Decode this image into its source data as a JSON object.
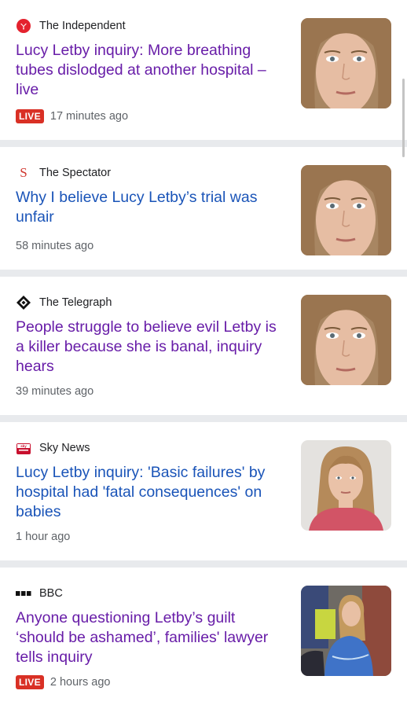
{
  "articles": [
    {
      "source": "The Independent",
      "icon": "independent-logo-icon",
      "headline": "Lucy Letby inquiry: More breathing tubes dislodged at another hospital – live",
      "live": "LIVE",
      "time": "17 minutes ago",
      "visited": true
    },
    {
      "source": "The Spectator",
      "icon": "spectator-logo-icon",
      "headline": "Why I believe Lucy Letby’s trial was unfair",
      "live": null,
      "time": "58 minutes ago",
      "visited": false
    },
    {
      "source": "The Telegraph",
      "icon": "telegraph-logo-icon",
      "headline": "People struggle to believe evil Letby is a killer because she is banal, inquiry hears",
      "live": null,
      "time": "39 minutes ago",
      "visited": true
    },
    {
      "source": "Sky News",
      "icon": "sky-news-logo-icon",
      "headline": "Lucy Letby inquiry: 'Basic failures' by hospital had 'fatal consequences' on babies",
      "live": null,
      "time": "1 hour ago",
      "visited": false
    },
    {
      "source": "BBC",
      "icon": "bbc-logo-icon",
      "headline": "Anyone questioning Letby’s guilt ‘should be ashamed’, families' lawyer tells inquiry",
      "live": "LIVE",
      "time": "2 hours ago",
      "visited": true
    }
  ],
  "colors": {
    "visited_link": "#681da8",
    "unvisited_link": "#1a54b8",
    "live_badge": "#d93025",
    "separator": "#e8eaed"
  }
}
